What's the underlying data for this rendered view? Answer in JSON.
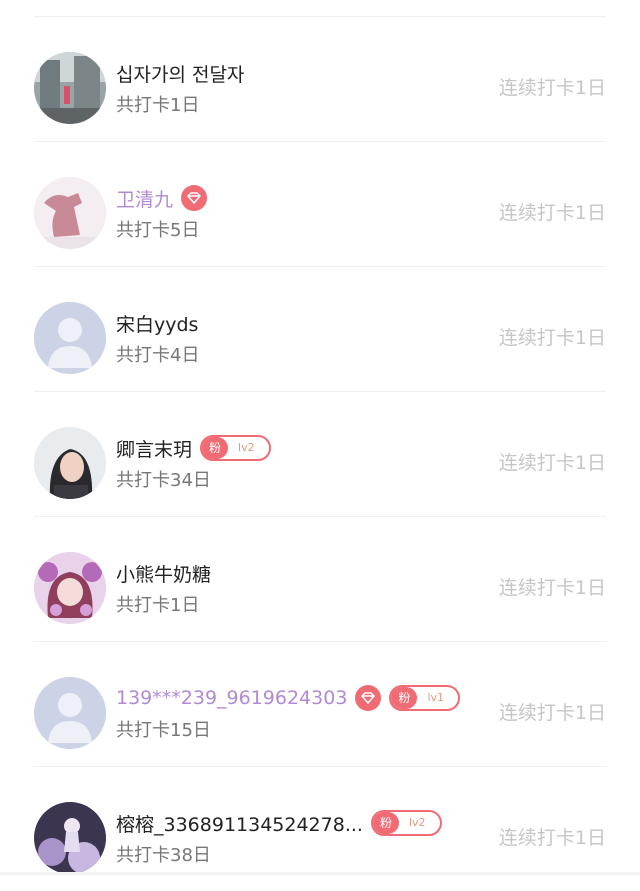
{
  "checkin_list": [
    {
      "name": "십자가의 전달자",
      "name_style": "normal",
      "total": "共打卡1日",
      "streak": "连续打卡1日",
      "avatar": "photo-street-icon",
      "diamond": false,
      "fan": null
    },
    {
      "name": "卫清九",
      "name_style": "vip",
      "total": "共打卡5日",
      "streak": "连续打卡1日",
      "avatar": "photo-pink-figure-icon",
      "diamond": true,
      "fan": null
    },
    {
      "name": "宋白yyds",
      "name_style": "normal",
      "total": "共打卡4日",
      "streak": "连续打卡1日",
      "avatar": "default-avatar-icon",
      "diamond": false,
      "fan": null
    },
    {
      "name": "卿言末玥",
      "name_style": "normal",
      "total": "共打卡34日",
      "streak": "连续打卡1日",
      "avatar": "photo-portrait-icon",
      "diamond": false,
      "fan": {
        "label": "粉",
        "level": "lv2"
      }
    },
    {
      "name": "小熊牛奶糖",
      "name_style": "normal",
      "total": "共打卡1日",
      "streak": "连续打卡1日",
      "avatar": "photo-anime-girl-icon",
      "diamond": false,
      "fan": null
    },
    {
      "name": "139***239_9619624303",
      "name_style": "vip",
      "total": "共打卡15日",
      "streak": "连续打卡1日",
      "avatar": "default-avatar-icon",
      "diamond": true,
      "fan": {
        "label": "粉",
        "level": "lv1"
      }
    },
    {
      "name": "榕榕_336891134524278...",
      "name_style": "normal",
      "total": "共打卡38日",
      "streak": "连续打卡1日",
      "avatar": "photo-night-flowers-icon",
      "diamond": false,
      "fan": {
        "label": "粉",
        "level": "lv2"
      }
    }
  ],
  "colors": {
    "vip_name": "#b18ad6",
    "badge": "#f06b74",
    "streak_text": "#c6c6c6",
    "sub_text": "#777777"
  }
}
